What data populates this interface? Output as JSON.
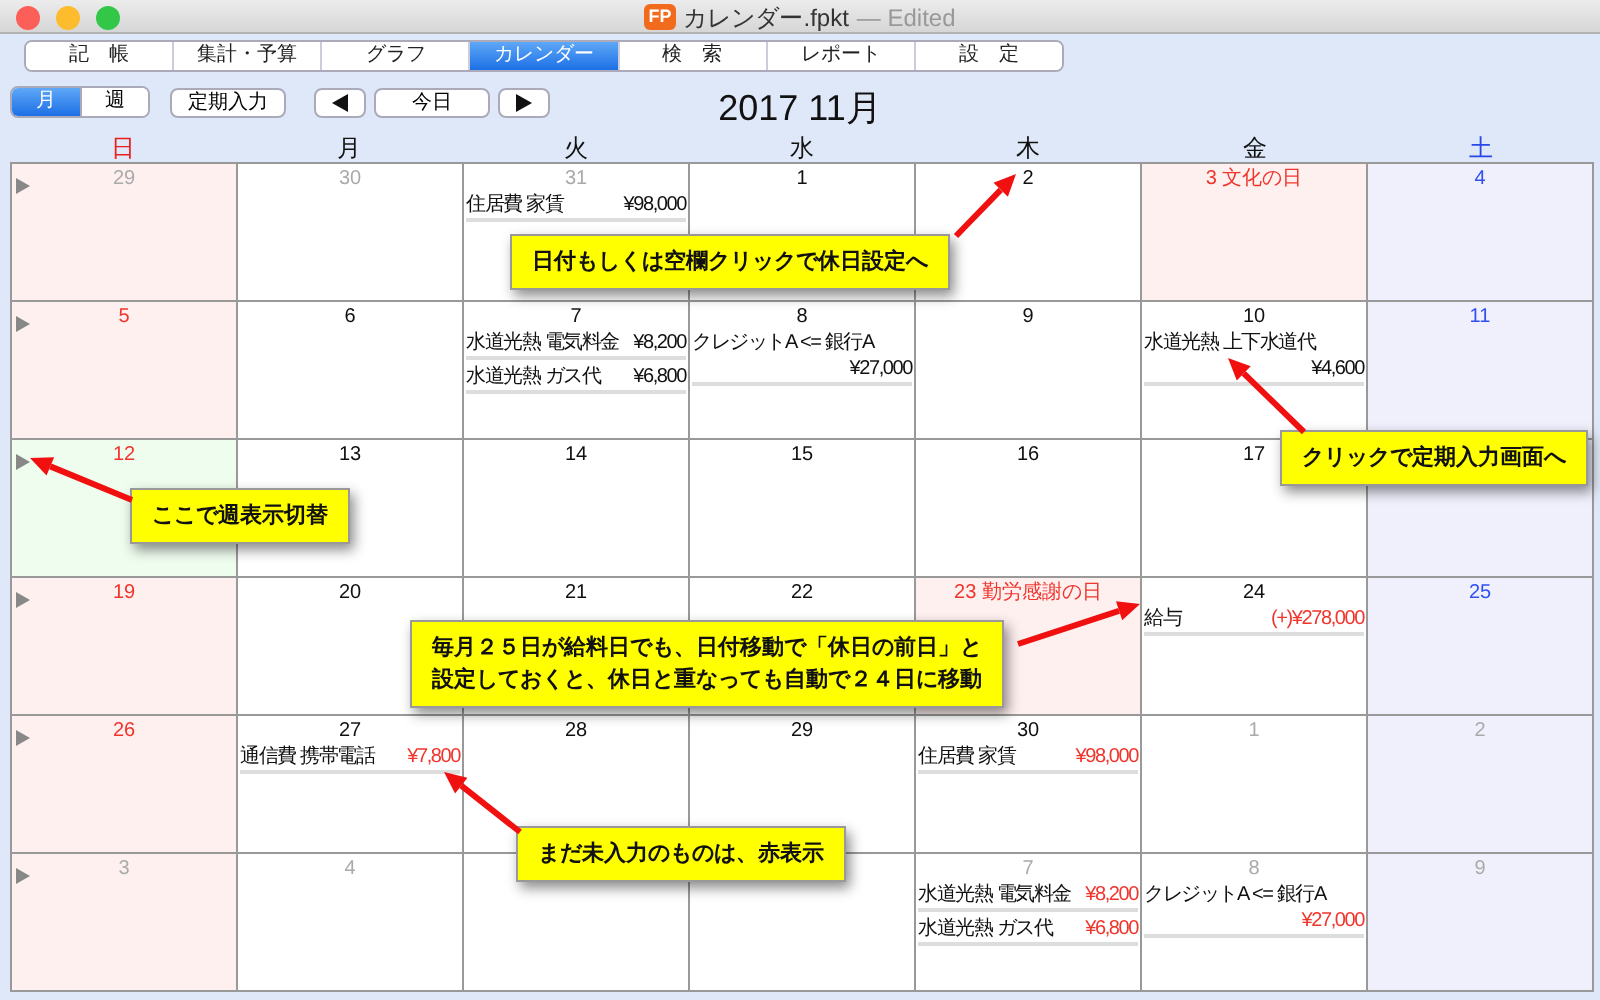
{
  "window": {
    "app_icon": "FP",
    "title": "カレンダー.fpkt",
    "status": "— Edited"
  },
  "tabs": [
    {
      "label": "記　帳",
      "selected": false
    },
    {
      "label": "集計・予算",
      "selected": false
    },
    {
      "label": "グラフ",
      "selected": false
    },
    {
      "label": "カレンダー",
      "selected": true
    },
    {
      "label": "検　索",
      "selected": false
    },
    {
      "label": "レポート",
      "selected": false
    },
    {
      "label": "設　定",
      "selected": false
    }
  ],
  "view_toggle": [
    {
      "label": "月",
      "selected": true
    },
    {
      "label": "週",
      "selected": false
    }
  ],
  "buttons": [
    {
      "kind": "text",
      "label": "定期入力"
    },
    {
      "kind": "prev"
    },
    {
      "kind": "text",
      "label": "今日"
    },
    {
      "kind": "next"
    }
  ],
  "month_title": "2017 11月",
  "weekdays": [
    "日",
    "月",
    "火",
    "水",
    "木",
    "金",
    "土"
  ],
  "weeks": [
    {
      "days": [
        {
          "date": "29",
          "in_month": false,
          "selected": false
        },
        {
          "date": "30",
          "in_month": false,
          "selected": false
        },
        {
          "date": "31",
          "in_month": false,
          "selected": false,
          "entries": [
            {
              "kind": "inline",
              "label": "住居費 家賃",
              "amount": "¥98,000",
              "entered": true
            }
          ]
        },
        {
          "date": "1",
          "in_month": true,
          "selected": false
        },
        {
          "date": "2",
          "in_month": true,
          "selected": false
        },
        {
          "date": "3",
          "in_month": true,
          "selected": false,
          "holiday": "文化の日"
        },
        {
          "date": "4",
          "in_month": true,
          "selected": false
        }
      ]
    },
    {
      "days": [
        {
          "date": "5",
          "in_month": true,
          "selected": false
        },
        {
          "date": "6",
          "in_month": true,
          "selected": false
        },
        {
          "date": "7",
          "in_month": true,
          "selected": false,
          "entries": [
            {
              "kind": "inline",
              "label": "水道光熱 電気料金",
              "amount": "¥8,200",
              "entered": true
            },
            {
              "kind": "inline",
              "label": "水道光熱 ガス代",
              "amount": "¥6,800",
              "entered": true
            }
          ]
        },
        {
          "date": "8",
          "in_month": true,
          "selected": false,
          "entries": [
            {
              "kind": "stacked",
              "label": "クレジットA <= 銀行A",
              "amount": "¥27,000",
              "entered": true
            }
          ]
        },
        {
          "date": "9",
          "in_month": true,
          "selected": false
        },
        {
          "date": "10",
          "in_month": true,
          "selected": false,
          "entries": [
            {
              "kind": "stacked",
              "label": "水道光熱 上下水道代",
              "amount": "¥4,600",
              "entered": true
            }
          ]
        },
        {
          "date": "11",
          "in_month": true,
          "selected": false
        }
      ]
    },
    {
      "days": [
        {
          "date": "12",
          "in_month": true,
          "selected": true
        },
        {
          "date": "13",
          "in_month": true,
          "selected": false
        },
        {
          "date": "14",
          "in_month": true,
          "selected": false
        },
        {
          "date": "15",
          "in_month": true,
          "selected": false
        },
        {
          "date": "16",
          "in_month": true,
          "selected": false
        },
        {
          "date": "17",
          "in_month": true,
          "selected": false
        },
        {
          "selected": false
        }
      ]
    },
    {
      "days": [
        {
          "date": "19",
          "in_month": true,
          "selected": false
        },
        {
          "date": "20",
          "in_month": true,
          "selected": false
        },
        {
          "date": "21",
          "in_month": true,
          "selected": false
        },
        {
          "date": "22",
          "in_month": true,
          "selected": false
        },
        {
          "date": "23",
          "in_month": true,
          "selected": false,
          "holiday": "勤労感謝の日"
        },
        {
          "date": "24",
          "in_month": true,
          "selected": false,
          "entries": [
            {
              "kind": "inline",
              "label": "給与",
              "amount": "(+)¥278,000",
              "entered": false
            }
          ]
        },
        {
          "date": "25",
          "in_month": true,
          "selected": false
        }
      ]
    },
    {
      "days": [
        {
          "date": "26",
          "in_month": true,
          "selected": false
        },
        {
          "date": "27",
          "in_month": true,
          "selected": false,
          "entries": [
            {
              "kind": "inline",
              "label": "通信費 携帯電話",
              "amount": "¥7,800",
              "entered": false
            }
          ]
        },
        {
          "date": "28",
          "in_month": true,
          "selected": false
        },
        {
          "date": "29",
          "in_month": true,
          "selected": false
        },
        {
          "date": "30",
          "in_month": true,
          "selected": false,
          "entries": [
            {
              "kind": "inline",
              "label": "住居費 家賃",
              "amount": "¥98,000",
              "entered": false
            }
          ]
        },
        {
          "date": "1",
          "in_month": false,
          "selected": false
        },
        {
          "date": "2",
          "in_month": false,
          "selected": false
        }
      ]
    },
    {
      "days": [
        {
          "date": "3",
          "in_month": false,
          "selected": false
        },
        {
          "date": "4",
          "in_month": false,
          "selected": false
        },
        {
          "selected": false
        },
        {
          "selected": false
        },
        {
          "date": "7",
          "in_month": false,
          "selected": false,
          "entries": [
            {
              "kind": "inline",
              "label": "水道光熱 電気料金",
              "amount": "¥8,200",
              "entered": false
            },
            {
              "kind": "inline",
              "label": "水道光熱 ガス代",
              "amount": "¥6,800",
              "entered": false
            }
          ]
        },
        {
          "date": "8",
          "in_month": false,
          "selected": false,
          "entries": [
            {
              "kind": "stacked",
              "label": "クレジットA <= 銀行A",
              "amount": "¥27,000",
              "entered": false
            }
          ]
        },
        {
          "date": "9",
          "in_month": false,
          "selected": false
        }
      ]
    }
  ],
  "callouts": [
    {
      "lines": [
        "日付もしくは空欄クリックで休日設定へ"
      ]
    },
    {
      "lines": [
        "クリックで定期入力画面へ"
      ]
    },
    {
      "lines": [
        "ここで週表示切替"
      ]
    },
    {
      "lines": [
        "毎月２５日が給料日でも、日付移動で「休日の前日」と",
        "設定しておくと、休日と重なっても自動で２４日に移動"
      ]
    },
    {
      "lines": [
        "まだ未入力のものは、赤表示"
      ]
    }
  ]
}
